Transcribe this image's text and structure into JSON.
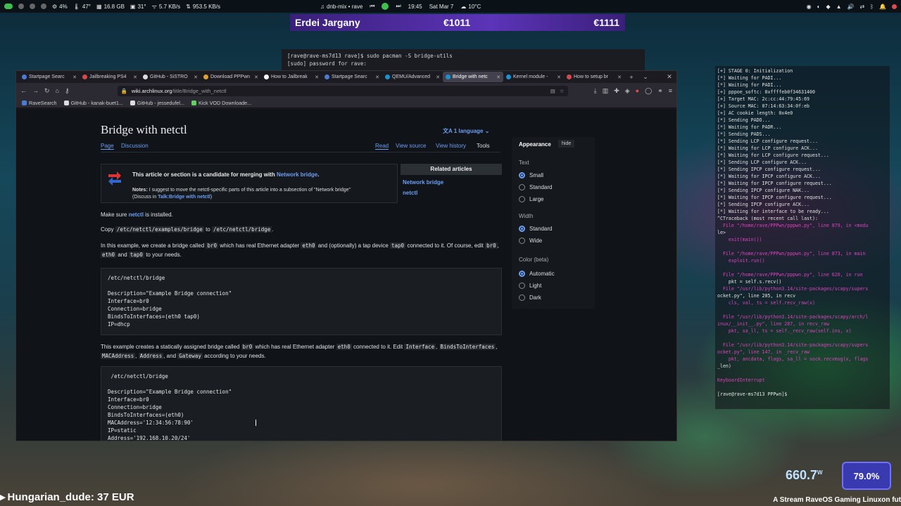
{
  "panel": {
    "cpu": "4%",
    "temp1": "47°",
    "ram": "16.8 GB",
    "temp2": "31°",
    "net_down": "5.7 KB/s",
    "net_up": "953.5 KB/s",
    "workspace": "dnb-mix • rave",
    "time": "19:45",
    "date": "Sat Mar 7",
    "weather": "10°C"
  },
  "donation_bar": {
    "name": "Erdei Jargany",
    "amount1": "€1011",
    "amount2": "€1111"
  },
  "terminal_back": {
    "line1": "[rave@rave-ms7d13 rave]$ sudo pacman -S bridge-utils",
    "line2": "[sudo] password for rave:"
  },
  "browser": {
    "tabs": [
      {
        "label": "Startpage Searc"
      },
      {
        "label": "Jailbreaking PS4"
      },
      {
        "label": "GitHub - SiSTRO"
      },
      {
        "label": "Download PPPwn"
      },
      {
        "label": "How to Jailbreak"
      },
      {
        "label": "Startpage Searc"
      },
      {
        "label": "QEMU/Advanced"
      },
      {
        "label": "Bridge with netc"
      },
      {
        "label": "Kernel module -"
      },
      {
        "label": "How to setup br"
      }
    ],
    "url_host": "wiki.archlinux.org",
    "url_path": "/title/Bridge_with_netctl",
    "bookmarks": [
      "RaveSearch",
      "GitHub - kanak-buet1...",
      "GitHub - jessedufel...",
      "Kick VOD Downloade..."
    ]
  },
  "wiki": {
    "title": "Bridge with netctl",
    "language": "1 language",
    "tab_page": "Page",
    "tab_discussion": "Discussion",
    "tab_read": "Read",
    "tab_view_source": "View source",
    "tab_view_history": "View history",
    "tab_tools": "Tools",
    "notice_title": "This article or section is a candidate for merging with",
    "notice_link": "Network bridge",
    "notice_notes_label": "Notes:",
    "notice_notes": "I suggest to move the netctl-specific parts of this article into a subsection of \"Network bridge\"",
    "notice_discuss_pre": "(Discuss in",
    "notice_discuss_link": "Talk:Bridge with netctl",
    "related_header": "Related articles",
    "related": [
      "Network bridge",
      "netctl"
    ],
    "p1_pre": "Make sure",
    "p1_link": "netctl",
    "p1_post": "is installed.",
    "p2_pre": "Copy",
    "p2_code1": "/etc/netctl/examples/bridge",
    "p2_mid": "to",
    "p2_code2": "/etc/netctl/bridge",
    "p3_a": "In this example, we create a bridge called",
    "p3_c1": "br0",
    "p3_b": "which has real Ethernet adapter",
    "p3_c2": "eth0",
    "p3_c": "and (optionally) a tap device",
    "p3_c3": "tap0",
    "p3_d": "connected to it. Of course, edit",
    "p3_c4": "br0",
    "p3_c5": "eth0",
    "p3_e": "and",
    "p3_c6": "tap0",
    "p3_f": "to your needs.",
    "code1": "/etc/netctl/bridge\n\nDescription=\"Example Bridge connection\"\nInterface=br0\nConnection=bridge\nBindsToInterfaces=(eth0 tap0)\nIP=dhcp",
    "p4_a": "This example creates a statically assigned bridge called",
    "p4_c1": "br0",
    "p4_b": "which has real Ethernet adapter",
    "p4_c2": "eth0",
    "p4_c": "connected to it. Edit",
    "p4_c3": "Interface",
    "p4_c4": "BindsToInterfaces",
    "p4_c5": "MACAddress",
    "p4_c6": "Address",
    "p4_d": ", and",
    "p4_c7": "Gateway",
    "p4_e": "according to your needs.",
    "code2": " /etc/netctl/bridge\n\nDescription=\"Example Bridge connection\"\nInterface=br0\nConnection=bridge\nBindsToInterfaces=(eth0)\nMACAddress='12:34:56:78:90'\nIP=static\nAddress='192.168.10.20/24'"
  },
  "appearance": {
    "title": "Appearance",
    "hide": "hide",
    "text_label": "Text",
    "text_options": [
      "Small",
      "Standard",
      "Large"
    ],
    "text_selected": "Small",
    "width_label": "Width",
    "width_options": [
      "Standard",
      "Wide"
    ],
    "width_selected": "Standard",
    "color_label": "Color (beta)",
    "color_options": [
      "Automatic",
      "Light",
      "Dark"
    ],
    "color_selected": "Automatic"
  },
  "terminal": {
    "lines": [
      "[+] STAGE 0: Initialization",
      "[*] Waiting for PADI...",
      "[*] Waiting for PADI...",
      "[+] pppoe_softc: 0xffffeb0f34631400",
      "[+] Target MAC: 2c:cc:44:79:45:69",
      "[+] Source MAC: 07:14:63:34:0f:eb",
      "[+] AC cookie length: 0x4e0",
      "[*] Sending PADO...",
      "[*] Waiting for PADR...",
      "[*] Sending PADS...",
      "[*] Sending LCP configure request...",
      "[*] Waiting for LCP configure ACK...",
      "[*] Waiting for LCP configure request...",
      "[*] Sending LCP configure ACK...",
      "[*] Sending IPCP configure request...",
      "[*] Waiting for IPCP configure ACK...",
      "[*] Waiting for IPCP configure request...",
      "[*] Sending IPCP configure NAK...",
      "[*] Waiting for IPCP configure request...",
      "[*] Sending IPCP configure ACK...",
      "[*] Waiting for interface to be ready...",
      "^CTraceback (most recent call last):",
      "  File \"/home/rave/PPPwn/pppwn.py\", line 879, in <modu",
      "le>",
      "    exit(main())",
      "",
      "  File \"/home/rave/PPPwn/pppwn.py\", line 873, in main",
      "    exploit.run()",
      "",
      "  File \"/home/rave/PPPwn/pppwn.py\", line 620, in run",
      "    pkt = self.s.recv()",
      "  File \"/usr/lib/python3.14/site-packages/scapy/supers",
      "ocket.py\", line 205, in recv",
      "    cls, val, ts = self.recv_raw(x)",
      "",
      "  File \"/usr/lib/python3.14/site-packages/scapy/arch/l",
      "inux/__init__.py\", line 287, in recv_raw",
      "    pkt, sa_ll, ts = self._recv_raw(self.ins, x)",
      "",
      "  File \"/usr/lib/python3.14/site-packages/scapy/supers",
      "ocket.py\", line 147, in _recv_raw",
      "    pkt, ancdata, flags, sa_ll = sock.recvmsg(x, flags",
      "_len)",
      "",
      "KeyboardInterrupt",
      "",
      "[rave@rave-ms7d13 PPPwn]$ "
    ]
  },
  "overlay": {
    "donor": "Hungarian_dude: 37 EUR",
    "power": "660.7",
    "power_unit": "W",
    "percent": "79.0%",
    "stream_title": "A Stream RaveOS Gaming Linuxon fut"
  }
}
